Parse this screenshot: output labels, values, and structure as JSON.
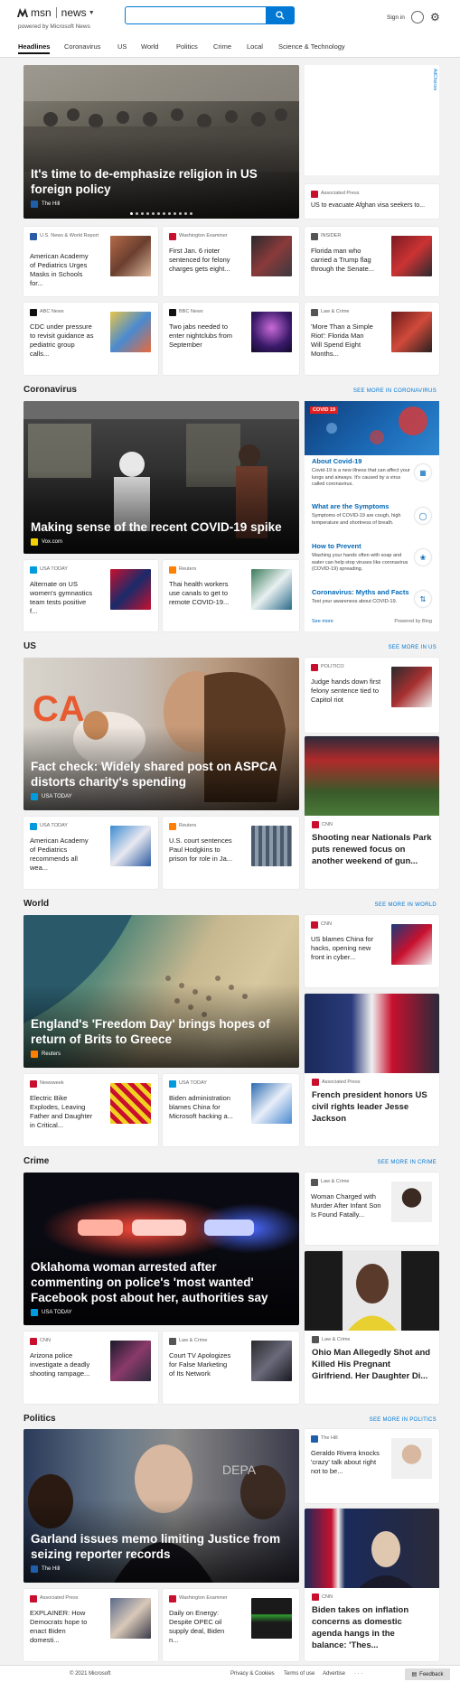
{
  "header": {
    "brand": "msn",
    "section": "news",
    "powered": "powered by Microsoft News",
    "search_placeholder": "",
    "signin": "Sign in"
  },
  "nav": [
    "Headlines",
    "Coronavirus",
    "US",
    "World",
    "Politics",
    "Crime",
    "Local",
    "Science & Technology"
  ],
  "adchoices": "AdChoices",
  "headlines": {
    "hero": {
      "title": "It's time to de-emphasize religion in US foreign policy",
      "source": "The Hill"
    },
    "side": {
      "source": "Associated Press",
      "title": "US to evacuate Afghan visa seekers to..."
    },
    "cards": [
      {
        "source": "U.S. News & World Report",
        "title": "American Academy of Pediatrics Urges Masks in Schools for..."
      },
      {
        "source": "Washington Examiner",
        "title": "First Jan. 6 rioter sentenced for felony charges gets eight..."
      },
      {
        "source": "INSIDER",
        "title": "Florida man who carried a Trump flag through the Senate..."
      },
      {
        "source": "ABC News",
        "title": "CDC under pressure to revisit guidance as pediatric group calls..."
      },
      {
        "source": "BBC News",
        "title": "Two jabs needed to enter nightclubs from September"
      },
      {
        "source": "Law & Crime",
        "title": "'More Than a Simple Riot': Florida Man Will Spend Eight Months..."
      }
    ]
  },
  "coronavirus": {
    "title": "Coronavirus",
    "see_more": "SEE MORE IN CORONAVIRUS",
    "hero": {
      "title": "Making sense of the recent COVID-19 spike",
      "source": "Vox.com"
    },
    "cards": [
      {
        "source": "USA TODAY",
        "title": "Alternate on US women's gymnastics team tests positive f..."
      },
      {
        "source": "Reuters",
        "title": "Thai health workers use canals to get to remote COVID-19..."
      }
    ],
    "box": {
      "badge": "COVID 19",
      "items": [
        {
          "h": "About Covid-19",
          "d": "Covid-19 is a new illness that can affect your lungs and airways. It's caused by a virus called coronavirus."
        },
        {
          "h": "What are the Symptoms",
          "d": "Symptoms of COVID-19 are cough, high temperature and shortness of breath."
        },
        {
          "h": "How to Prevent",
          "d": "Washing your hands often with soap and water can help stop viruses like coronavirus (COVID-19) spreading."
        },
        {
          "h": "Coronavirus: Myths and Facts",
          "d": "Test your awareness about COVID-19."
        }
      ],
      "see_more": "See more",
      "powered": "Powered by Bing"
    }
  },
  "us": {
    "title": "US",
    "see_more": "SEE MORE IN US",
    "hero": {
      "title": "Fact check: Widely shared post on ASPCA distorts charity's spending",
      "source": "USA TODAY"
    },
    "side": {
      "source": "POLITICO",
      "title": "Judge hands down first felony sentence tied to Capitol riot"
    },
    "cards": [
      {
        "source": "USA TODAY",
        "title": "American Academy of Pediatrics recommends all wea..."
      },
      {
        "source": "Reuters",
        "title": "U.S. court sentences Paul Hodgkins to prison for role in Ja..."
      }
    ],
    "tall": {
      "source": "CNN",
      "title": "Shooting near Nationals Park puts renewed focus on another weekend of gun..."
    }
  },
  "world": {
    "title": "World",
    "see_more": "SEE MORE IN WORLD",
    "hero": {
      "title": "England's 'Freedom Day' brings hopes of return of Brits to Greece",
      "source": "Reuters"
    },
    "side": {
      "source": "CNN",
      "title": "US blames China for hacks, opening new front in cyber..."
    },
    "cards": [
      {
        "source": "Newsweek",
        "title": "Electric Bike Explodes, Leaving Father and Daughter in Critical..."
      },
      {
        "source": "USA TODAY",
        "title": "Biden administration blames China for Microsoft hacking a..."
      }
    ],
    "tall": {
      "source": "Associated Press",
      "title": "French president honors US civil rights leader Jesse Jackson"
    }
  },
  "crime": {
    "title": "Crime",
    "see_more": "SEE MORE IN CRIME",
    "hero": {
      "title": "Oklahoma woman arrested after commenting on police's 'most wanted' Facebook post about her, authorities say",
      "source": "USA TODAY"
    },
    "side": {
      "source": "Law & Crime",
      "title": "Woman Charged with Murder After Infant Son Is Found Fatally..."
    },
    "cards": [
      {
        "source": "CNN",
        "title": "Arizona police investigate a deadly shooting rampage..."
      },
      {
        "source": "Law & Crime",
        "title": "Court TV Apologizes for False Marketing of Its Network"
      }
    ],
    "tall": {
      "source": "Law & Crime",
      "title": "Ohio Man Allegedly Shot and Killed His Pregnant Girlfriend. Her Daughter Di..."
    }
  },
  "politics": {
    "title": "Politics",
    "see_more": "SEE MORE IN POLITICS",
    "hero": {
      "title": "Garland issues memo limiting Justice from seizing reporter records",
      "source": "The Hill"
    },
    "side": {
      "source": "The Hill",
      "title": "Geraldo Rivera knocks 'crazy' talk about right not to be..."
    },
    "cards": [
      {
        "source": "Associated Press",
        "title": "EXPLAINER: How Democrats hope to enact Biden domesti..."
      },
      {
        "source": "Washington Examiner",
        "title": "Daily on Energy: Despite OPEC oil supply deal, Biden n..."
      }
    ],
    "tall": {
      "source": "CNN",
      "title": "Biden takes on inflation concerns as domestic agenda hangs in the balance: 'Thes..."
    }
  },
  "footer": {
    "copyright": "© 2021 Microsoft",
    "links": [
      "Privacy & Cookies",
      "Terms of use",
      "Advertise"
    ],
    "more": "· · ·",
    "feedback": "Feedback"
  }
}
